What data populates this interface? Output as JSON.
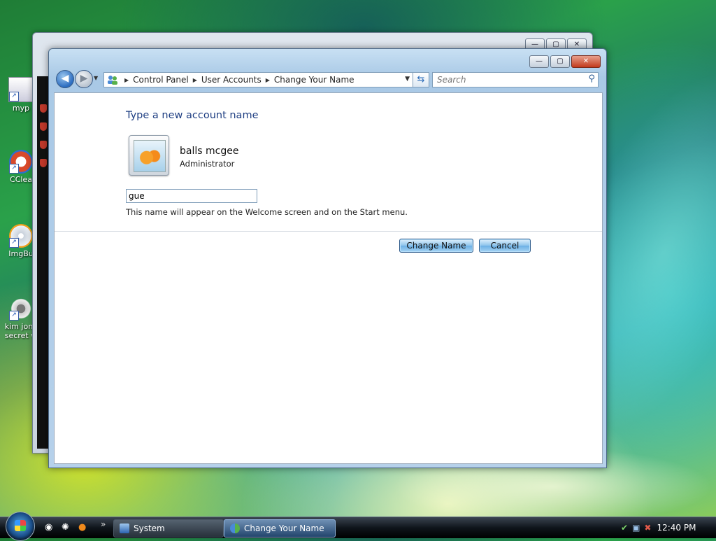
{
  "desktop": {
    "icons": [
      {
        "label": "myp",
        "icon": "program-icon"
      },
      {
        "label": "CClea",
        "icon": "ccleaner-icon"
      },
      {
        "label": "ImgBu",
        "icon": "disc-icon"
      },
      {
        "label": "kim jonc",
        "label2": "secret w",
        "icon": "gear-icon"
      }
    ]
  },
  "window": {
    "title": "Change Your Name",
    "breadcrumbs": [
      "Control Panel",
      "User Accounts",
      "Change Your Name"
    ],
    "search_placeholder": "Search",
    "controls": {
      "minimize": "—",
      "maximize": "▢",
      "close": "✕"
    }
  },
  "content": {
    "heading": "Type a new account name",
    "user_name": "balls mcgee",
    "user_role": "Administrator",
    "name_input_value": "gue",
    "helper_text": "This name will appear on the Welcome screen and on the Start menu.",
    "change_button": "Change Name",
    "cancel_button": "Cancel"
  },
  "taskbar": {
    "tasks": [
      {
        "label": "System",
        "active": false
      },
      {
        "label": "Change Your Name",
        "active": true
      }
    ],
    "clock": "12:40 PM",
    "accent": "#3a80c8"
  }
}
